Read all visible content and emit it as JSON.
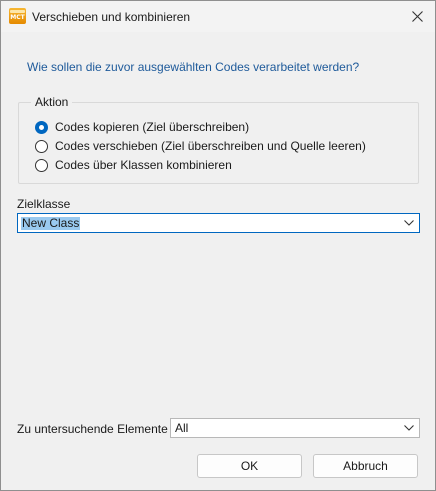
{
  "window": {
    "title": "Verschieben und kombinieren",
    "app_icon_text": "MCT"
  },
  "prompt": "Wie sollen die zuvor ausgewählten Codes verarbeitet werden?",
  "action_group": {
    "title": "Aktion",
    "options": [
      {
        "label": "Codes kopieren (Ziel überschreiben)",
        "checked": true
      },
      {
        "label": "Codes verschieben (Ziel überschreiben und Quelle leeren)",
        "checked": false
      },
      {
        "label": "Codes über Klassen kombinieren",
        "checked": false
      }
    ]
  },
  "target_class": {
    "label": "Zielklasse",
    "value": "New Class"
  },
  "elements": {
    "label": "Zu untersuchende Elemente",
    "value": "All"
  },
  "buttons": {
    "ok": "OK",
    "cancel": "Abbruch"
  },
  "colors": {
    "accent": "#0067c0",
    "prompt_text": "#1e5a9a",
    "selection": "#99c9ef",
    "dialog_bg": "#f0f0f0"
  }
}
